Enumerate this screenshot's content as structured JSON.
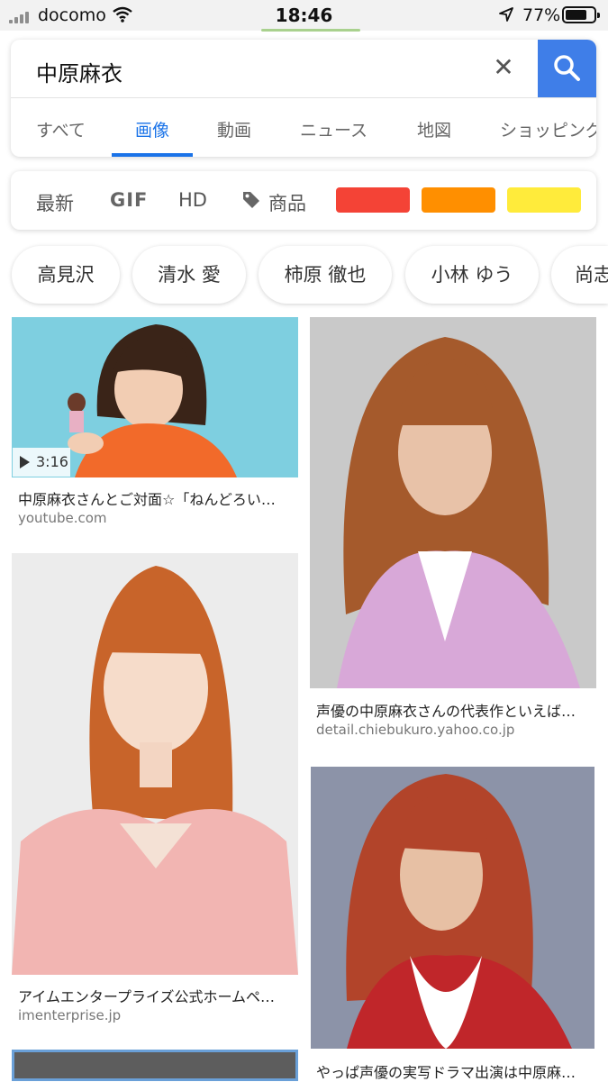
{
  "status_bar": {
    "carrier": "docomo",
    "time": "18:46",
    "battery_percent": "77%",
    "battery_level": 0.77
  },
  "search": {
    "query": "中原麻衣",
    "tabs": [
      {
        "label": "すべて",
        "active": false
      },
      {
        "label": "画像",
        "active": true
      },
      {
        "label": "動画",
        "active": false
      },
      {
        "label": "ニュース",
        "active": false
      },
      {
        "label": "地図",
        "active": false
      },
      {
        "label": "ショッピング",
        "active": false
      }
    ]
  },
  "filters": {
    "latest": "最新",
    "gif": "GIF",
    "hd": "HD",
    "products": "商品",
    "color_swatches": [
      "#f44336",
      "#ff8f00",
      "#ffeb3b"
    ]
  },
  "related_chips": [
    "高見沢",
    "清水 愛",
    "柿原 徹也",
    "小林 ゆう",
    "尚志"
  ],
  "results": [
    {
      "caption": "中原麻衣さんとご対面☆「ねんどろい…",
      "source": "youtube.com",
      "duration": "3:16"
    },
    {
      "caption": "声優の中原麻衣さんの代表作といえば…",
      "source": "detail.chiebukuro.yahoo.co.jp"
    },
    {
      "caption": "アイムエンタープライズ公式ホームペ…",
      "source": "imenterprise.jp"
    },
    {
      "caption": "やっぱ声優の実写ドラマ出演は中原麻…",
      "source": ""
    }
  ]
}
